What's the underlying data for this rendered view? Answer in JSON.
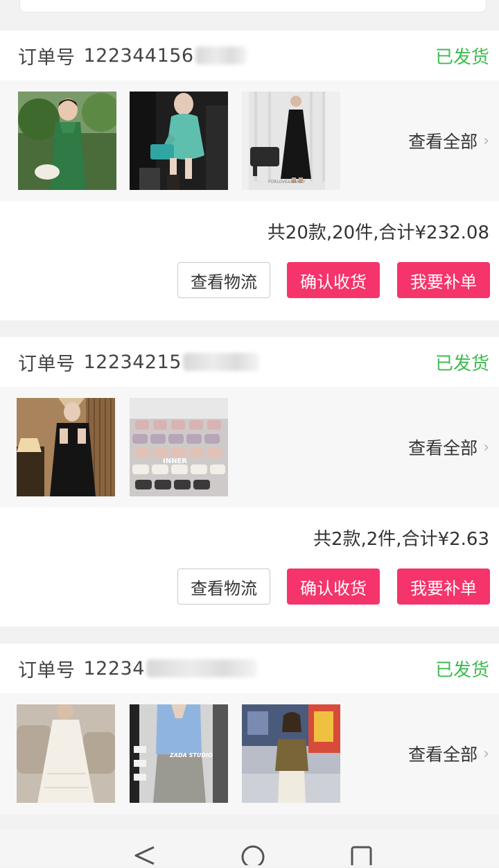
{
  "orders": [
    {
      "label": "订单号",
      "number_visible": "122344156",
      "status": "已发货",
      "view_all": "查看全部",
      "summary": "共20款,20件,合计¥232.08",
      "buttons": {
        "logistics": "查看物流",
        "confirm": "确认收货",
        "reorder": "我要补单"
      }
    },
    {
      "label": "订单号",
      "number_visible": "12234215",
      "status": "已发货",
      "view_all": "查看全部",
      "summary": "共2款,2件,合计¥2.63",
      "buttons": {
        "logistics": "查看物流",
        "confirm": "确认收货",
        "reorder": "我要补单"
      }
    },
    {
      "label": "订单号",
      "number_visible": "12234",
      "status": "已发货",
      "view_all": "查看全部"
    }
  ],
  "thumbnail_text": {
    "forlove": "FORLOVE&NANCY",
    "inner": "INNER",
    "zada": "ZADA STUDIO"
  },
  "colors": {
    "status_green": "#3dbb4f",
    "accent_pink": "#f4346a"
  },
  "navbar": {
    "icons": [
      "back-triangle-icon",
      "home-circle-icon",
      "recents-square-icon"
    ]
  }
}
